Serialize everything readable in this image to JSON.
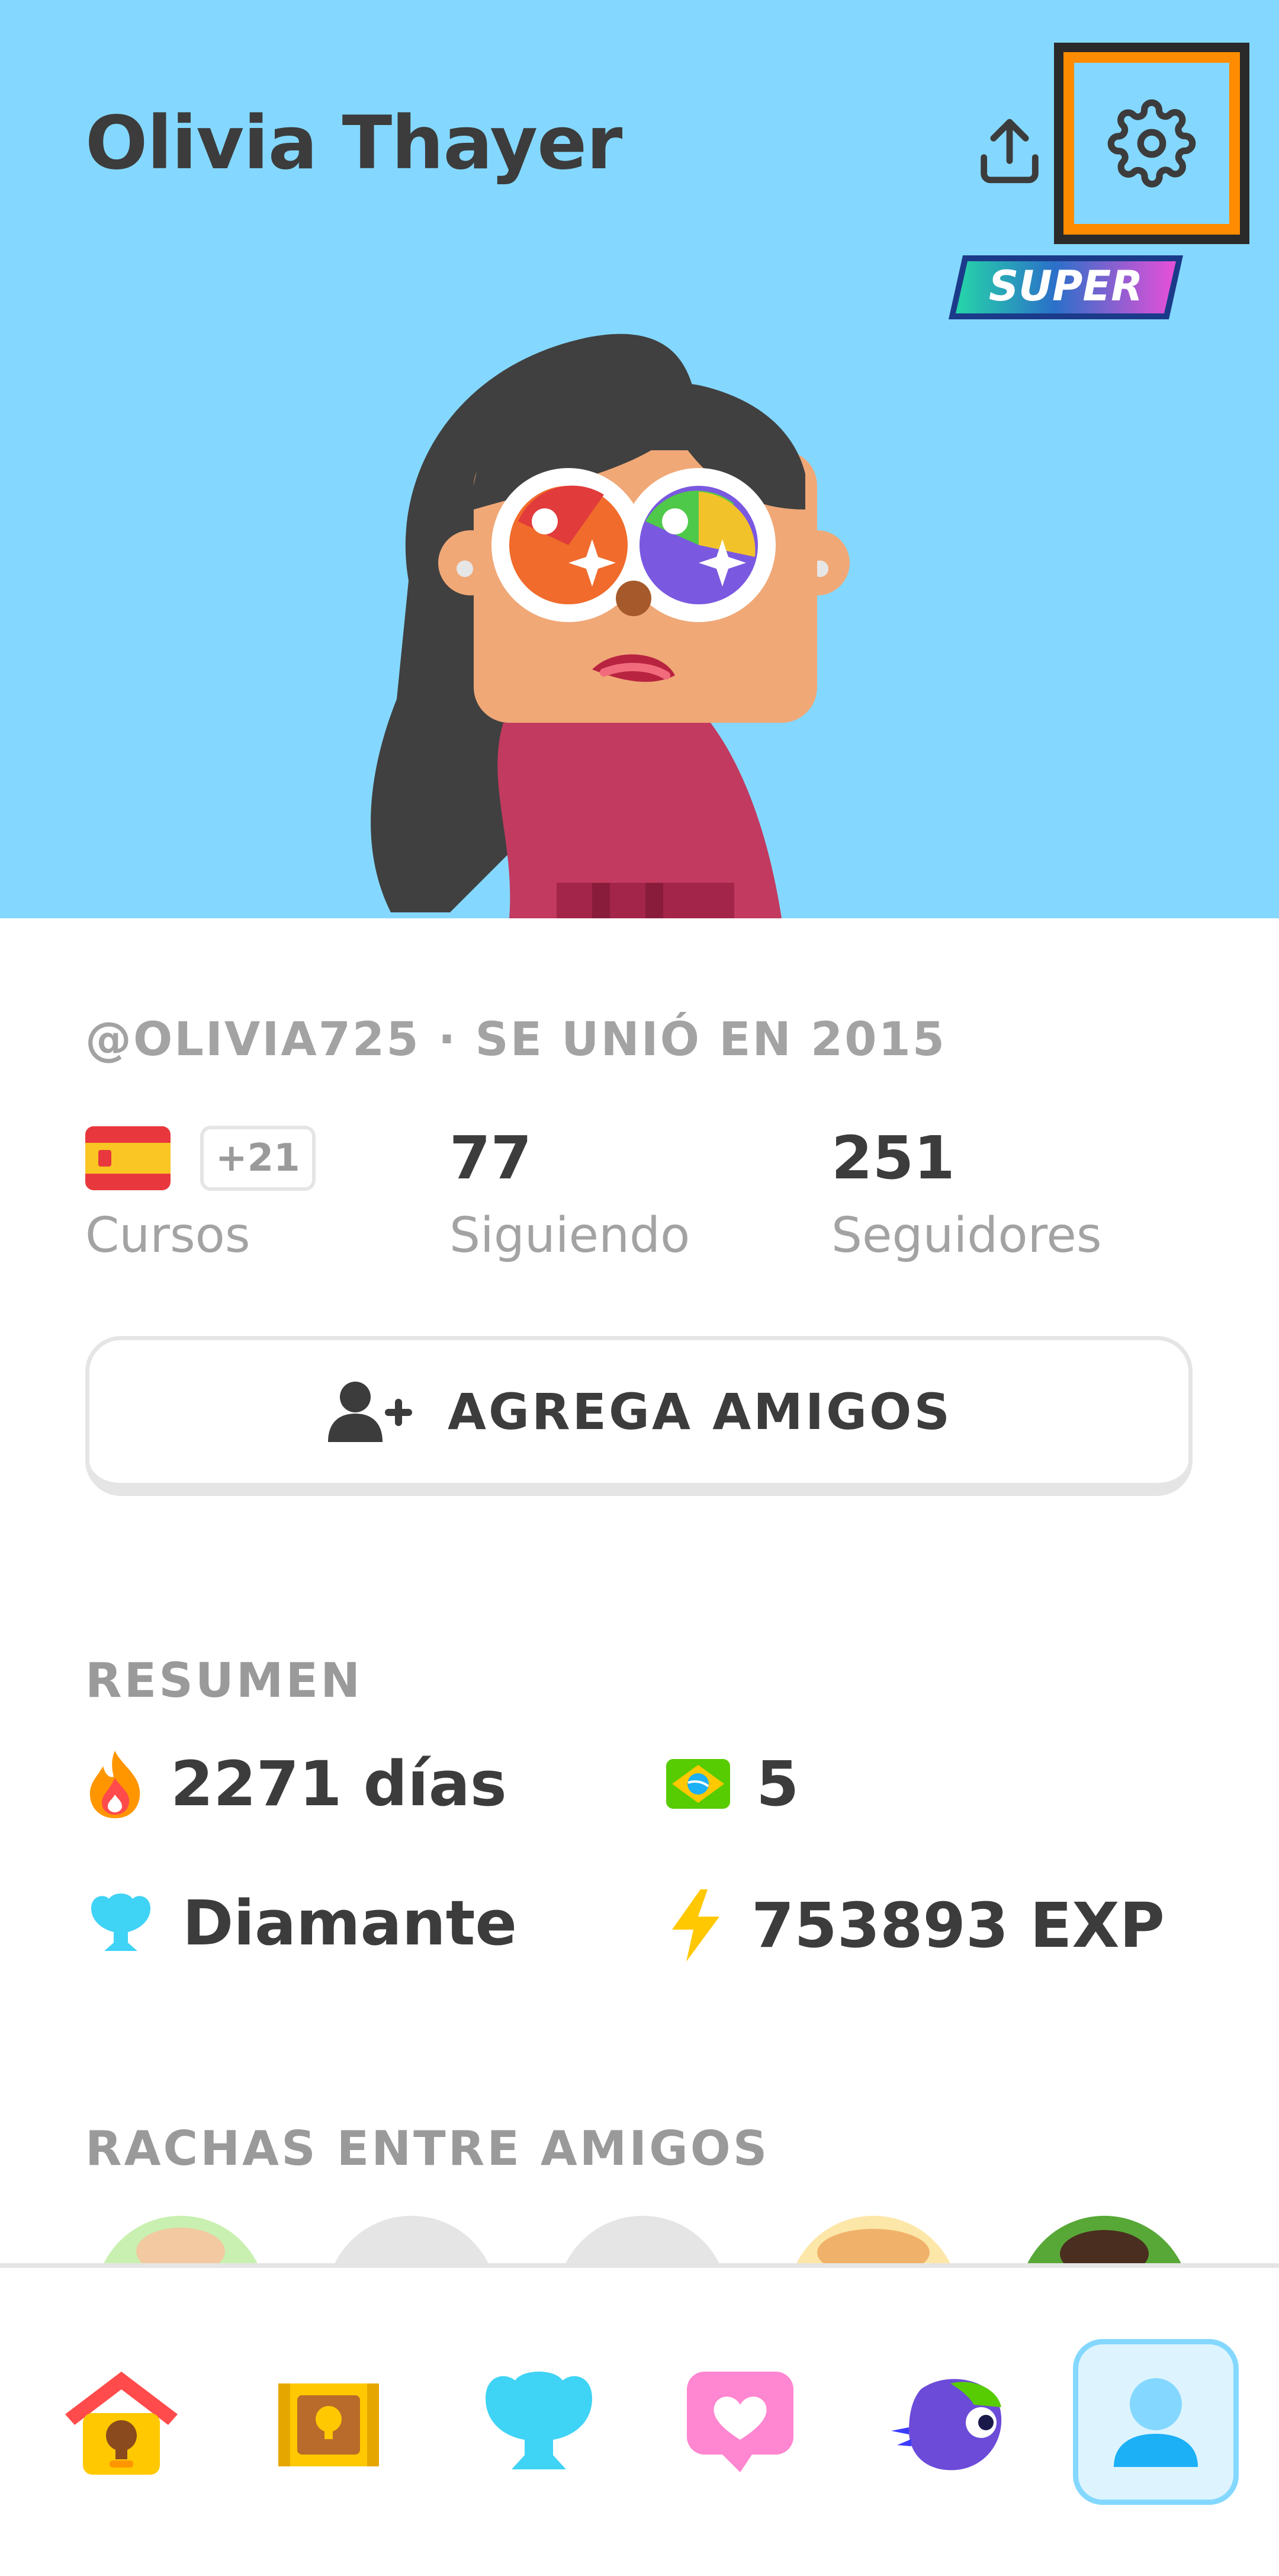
{
  "header": {
    "name": "Olivia Thayer",
    "badge": "SUPER"
  },
  "profile": {
    "meta": "@OLIVIA725 · SE UNIÓ EN 2015",
    "courses_extra": "+21",
    "courses_label": "Cursos",
    "following_value": "77",
    "following_label": "Siguiendo",
    "followers_value": "251",
    "followers_label": "Seguidores"
  },
  "add_friends_label": "AGREGA AMIGOS",
  "summary": {
    "title": "RESUMEN",
    "streak": "2271 días",
    "crowns": "5",
    "league": "Diamante",
    "xp": "753893 EXP"
  },
  "friend_streaks_title": "RACHAS ENTRE AMIGOS",
  "colors": {
    "hero_bg": "#84d8ff",
    "highlight": "#ff8c00",
    "active_nav_bg": "#ddf4ff"
  },
  "icons": [
    "upload-icon",
    "gear-icon",
    "add-user-icon",
    "flame-icon",
    "brazil-flag-icon",
    "trophy-icon",
    "lightning-icon",
    "home-icon",
    "chest-icon",
    "league-icon",
    "heart-icon",
    "duo-icon",
    "profile-icon"
  ]
}
